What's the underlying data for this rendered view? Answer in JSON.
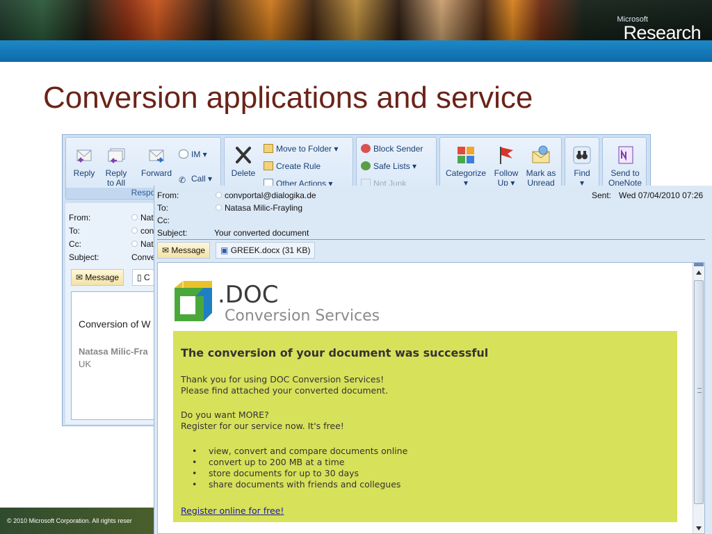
{
  "banner": {
    "ms_small": "Microsoft",
    "ms_research": "Research"
  },
  "slide_title": "Conversion applications and service",
  "back_window": {
    "ribbon": {
      "respond_buttons": [
        "Reply",
        "Reply to All",
        "Forward"
      ],
      "respond_reply_to_all_line1": "Reply",
      "respond_reply_to_all_line2": "to All",
      "im": "IM",
      "call": "Call",
      "respond_group_label": "Respo",
      "delete": "Delete",
      "move_to_folder": "Move to Folder",
      "create_rule": "Create Rule",
      "other_actions": "Other Actions",
      "block_sender": "Block Sender",
      "safe_lists": "Safe Lists",
      "not_junk": "Not Junk",
      "categorize": "Categorize",
      "follow_up_1": "Follow",
      "follow_up_2": "Up",
      "mark_as_unread_1": "Mark as",
      "mark_as_unread_2": "Unread",
      "find": "Find",
      "send_to_onenote_1": "Send to",
      "send_to_onenote_2": "OneNote"
    },
    "header": {
      "from_label": "From:",
      "from_value": "Nat",
      "to_label": "To:",
      "to_value": "con",
      "cc_label": "Cc:",
      "cc_value": "Nat",
      "subject_label": "Subject:",
      "subject_value": "Conve"
    },
    "tabs": {
      "message": "Message",
      "attachment_partial": "C"
    },
    "body": {
      "line1": "Conversion of W",
      "sig_name": "Natasa Milic-Fra",
      "sig_country": "UK"
    }
  },
  "front_window": {
    "header": {
      "from_label": "From:",
      "from_value": "convportal@dialogika.de",
      "to_label": "To:",
      "to_value": "Natasa Milic-Frayling",
      "cc_label": "Cc:",
      "subject_label": "Subject:",
      "subject_value": "Your converted document",
      "sent_label": "Sent:",
      "sent_value": "Wed 07/04/2010 07:26"
    },
    "tabs": {
      "message": "Message",
      "attachment": "GREEK.docx (31 KB)"
    },
    "brand": {
      "doc": ".DOC",
      "sub": "Conversion Services"
    },
    "content": {
      "title": "The conversion of your document was successful",
      "line1": "Thank you for using DOC Conversion Services!",
      "line2": "Please find attached your converted document.",
      "line3": "Do you want MORE?",
      "line4": "Register for our service now. It's free!",
      "bullets": [
        "view, convert and compare documents online",
        "convert up to 200 MB at a time",
        "store documents for up to 30 days",
        "share documents with friends and collegues"
      ],
      "link": "Register online for free!"
    }
  },
  "footer": {
    "text": "© 2010 Microsoft Corporation. All rights reser"
  }
}
